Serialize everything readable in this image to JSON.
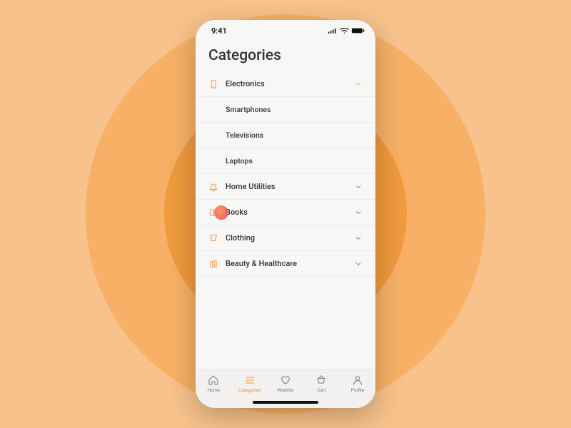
{
  "status": {
    "time": "9:41"
  },
  "header": {
    "title": "Categories"
  },
  "categories": [
    {
      "name": "Electronics",
      "expanded": true,
      "children": [
        "Smartphones",
        "Televisions",
        "Laptops"
      ]
    },
    {
      "name": "Home Utilities",
      "expanded": false
    },
    {
      "name": "Books",
      "expanded": false,
      "touch": true
    },
    {
      "name": "Clothing",
      "expanded": false
    },
    {
      "name": "Beauty & Healthcare",
      "expanded": false
    }
  ],
  "tabs": [
    {
      "label": "Home",
      "active": false
    },
    {
      "label": "Categories",
      "active": true
    },
    {
      "label": "Wishlist",
      "active": false
    },
    {
      "label": "Cart",
      "active": false
    },
    {
      "label": "Profile",
      "active": false
    }
  ]
}
